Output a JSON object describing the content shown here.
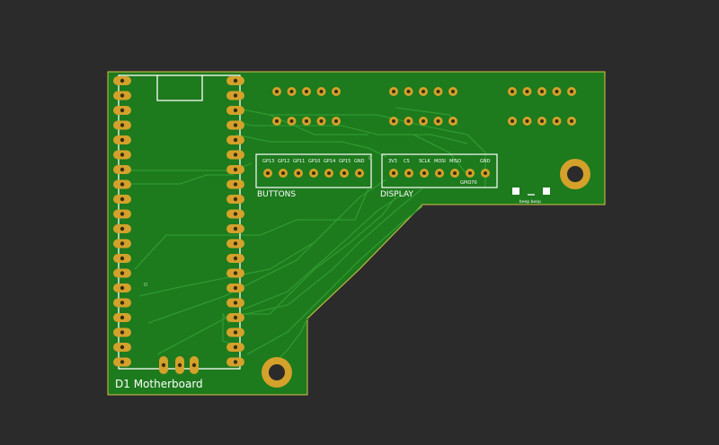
{
  "board": {
    "title": "D1 Motherboard",
    "colors": {
      "background": "#2b2b2b",
      "pcb": "#1d7a1d",
      "trace": "#2f9a2f",
      "silk": "#ffffff",
      "pad": "#d4a12a",
      "drill": "#3a2e12"
    }
  },
  "buttons_header": {
    "label": "BUTTONS",
    "pins": [
      "GP13",
      "GP12",
      "GP11",
      "GP10",
      "GP14",
      "GP15",
      "GND"
    ]
  },
  "display_header": {
    "label": "DISPLAY",
    "pins": [
      "3V3",
      "CS",
      "SCLK",
      "MOSI",
      "MISO",
      "",
      "GND"
    ],
    "sub_label": "GPIO70"
  },
  "beeper": {
    "label": "beep beep"
  }
}
